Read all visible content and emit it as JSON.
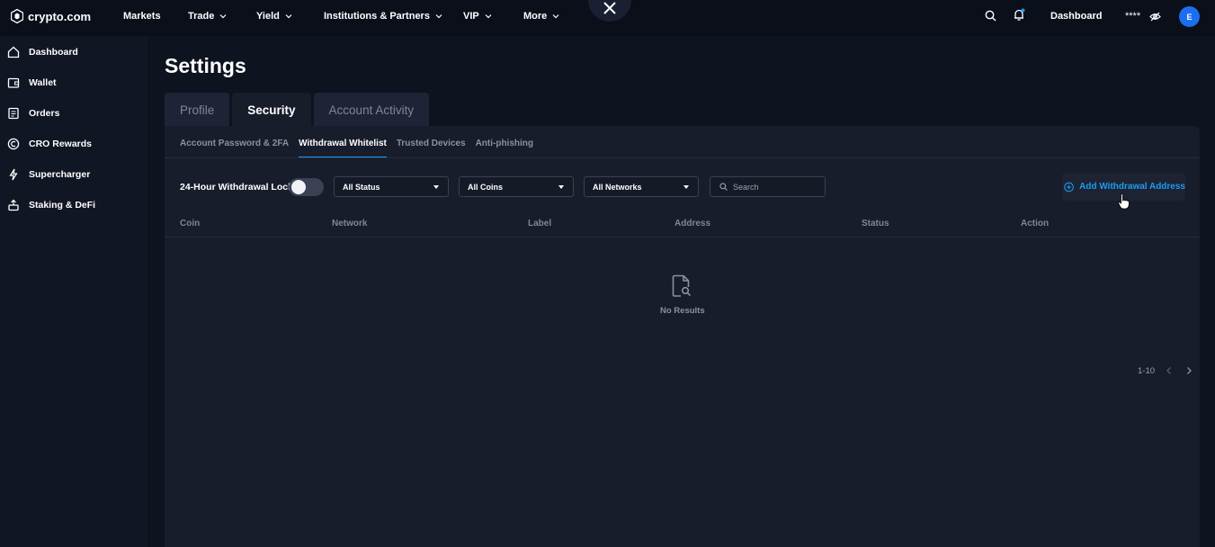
{
  "brand": {
    "name": "crypto.com"
  },
  "nav": {
    "items": [
      {
        "label": "Markets",
        "dropdown": false
      },
      {
        "label": "Trade",
        "dropdown": true
      },
      {
        "label": "Yield",
        "dropdown": true
      },
      {
        "label": "Institutions & Partners",
        "dropdown": true
      },
      {
        "label": "VIP",
        "dropdown": true
      },
      {
        "label": "More",
        "dropdown": true
      }
    ],
    "dashboard_label": "Dashboard",
    "hidden_balance": "****",
    "avatar_initial": "E"
  },
  "sidebar": {
    "items": [
      {
        "label": "Dashboard",
        "icon": "home-icon"
      },
      {
        "label": "Wallet",
        "icon": "wallet-icon"
      },
      {
        "label": "Orders",
        "icon": "orders-icon"
      },
      {
        "label": "CRO Rewards",
        "icon": "rewards-icon"
      },
      {
        "label": "Supercharger",
        "icon": "lightning-icon"
      },
      {
        "label": "Staking & DeFi",
        "icon": "staking-icon"
      }
    ]
  },
  "page": {
    "title": "Settings",
    "tabs": [
      {
        "label": "Profile",
        "active": false
      },
      {
        "label": "Security",
        "active": true
      },
      {
        "label": "Account Activity",
        "active": false
      }
    ],
    "subtabs": [
      {
        "label": "Account Password & 2FA",
        "active": false
      },
      {
        "label": "Withdrawal Whitelist",
        "active": true
      },
      {
        "label": "Trusted Devices",
        "active": false
      },
      {
        "label": "Anti-phishing",
        "active": false
      }
    ]
  },
  "filters": {
    "lock_label": "24-Hour Withdrawal Lock",
    "lock_enabled": false,
    "status_select": "All Status",
    "coins_select": "All Coins",
    "networks_select": "All Networks",
    "search_placeholder": "Search",
    "add_button": "Add Withdrawal Address"
  },
  "table": {
    "columns": [
      "Coin",
      "Network",
      "Label",
      "Address",
      "Status",
      "Action"
    ],
    "rows": [],
    "empty_text": "No Results"
  },
  "pagination": {
    "range": "1-10"
  },
  "colors": {
    "accent": "#1b9cf0",
    "background": "#0e1320",
    "panel": "#181d2b",
    "avatar": "#1b6ef0"
  }
}
